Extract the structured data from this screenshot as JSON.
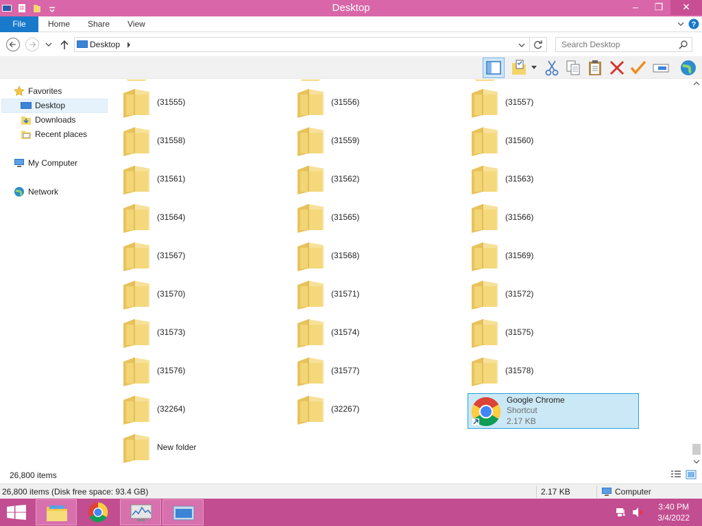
{
  "window": {
    "title": "Desktop"
  },
  "ribbon": {
    "tabs": [
      "File",
      "Home",
      "Share",
      "View"
    ]
  },
  "address": {
    "location": "Desktop"
  },
  "search": {
    "placeholder": "Search Desktop"
  },
  "sidebar": {
    "favorites": "Favorites",
    "favorites_items": [
      "Desktop",
      "Downloads",
      "Recent places"
    ],
    "computer": "My Computer",
    "network": "Network"
  },
  "folders": [
    "(31555)",
    "(31556)",
    "(31557)",
    "(31558)",
    "(31559)",
    "(31560)",
    "(31561)",
    "(31562)",
    "(31563)",
    "(31564)",
    "(31565)",
    "(31566)",
    "(31567)",
    "(31568)",
    "(31569)",
    "(31570)",
    "(31571)",
    "(31572)",
    "(31573)",
    "(31574)",
    "(31575)",
    "(31576)",
    "(31577)",
    "(31578)",
    "(32264)",
    "(32267)"
  ],
  "shortcut": {
    "name": "Google Chrome",
    "type": "Shortcut",
    "size": "2.17 KB"
  },
  "last_folder": "New folder",
  "status": {
    "items_count": "26,800 items",
    "disk_info": "26,800 items (Disk free space: 93.4 GB)",
    "selected_size": "2.17 KB",
    "location": "Computer"
  },
  "taskbar": {
    "time": "3:40 PM",
    "date": "3/4/2022"
  },
  "colors": {
    "titlebar": "#d866a8",
    "taskbar": "#c24d90",
    "file_tab": "#1979ca",
    "selection": "#cbe8f6",
    "folder": "#f3dd8a"
  }
}
